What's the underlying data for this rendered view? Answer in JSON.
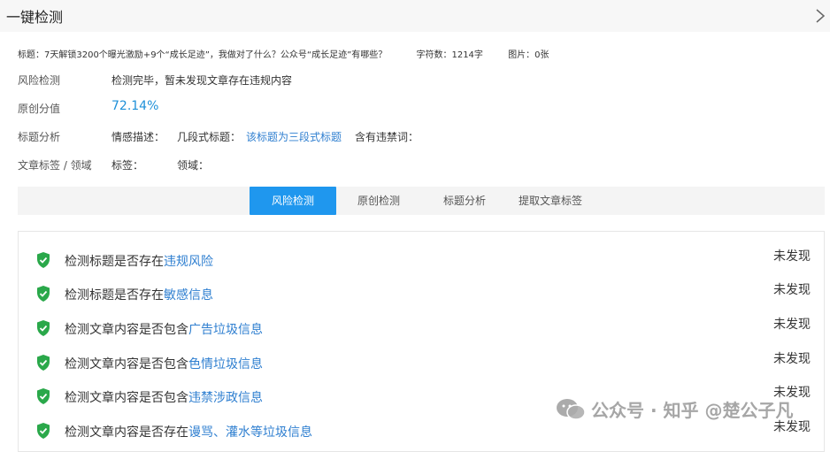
{
  "header": {
    "title": "一键检测"
  },
  "info": {
    "title_text": "标题：7天解锁3200个曝光激励+9个“成长足迹”，我做对了什么？公众号“成长足迹”有哪些？",
    "word_count": "字符数：1214字",
    "images": "图片：0张"
  },
  "rows": {
    "risk": {
      "label": "风险检测",
      "value": "检测完毕，暂未发现文章存在违规内容"
    },
    "originality": {
      "label": "原创分值",
      "value": "72.14%"
    },
    "title_analysis": {
      "label": "标题分析",
      "sentiment": "情感描述：",
      "segments_label": "几段式标题：",
      "segments_value": "该标题为三段式标题",
      "banned": "含有违禁词："
    },
    "tags": {
      "label": "文章标签 / 领域",
      "tags_label": "标签：",
      "domain_label": "领域："
    }
  },
  "tabs": [
    "风险检测",
    "原创检测",
    "标题分析",
    "提取文章标签"
  ],
  "checks": [
    {
      "prefix": "检测标题是否存在",
      "link": "违规风险",
      "status": "未发现"
    },
    {
      "prefix": "检测标题是否存在",
      "link": "敏感信息",
      "status": "未发现"
    },
    {
      "prefix": "检测文章内容是否包含",
      "link": "广告垃圾信息",
      "status": "未发现"
    },
    {
      "prefix": "检测文章内容是否包含",
      "link": "色情垃圾信息",
      "status": "未发现"
    },
    {
      "prefix": "检测文章内容是否包含",
      "link": "违禁涉政信息",
      "status": "未发现"
    },
    {
      "prefix": "检测文章内容是否存在",
      "link": "谩骂、灌水等垃圾信息",
      "status": "未发现"
    }
  ],
  "watermark": "公众号 · 知乎 @楚公子凡",
  "colors": {
    "accent": "#1f97ee",
    "link": "#2f7fd0",
    "shield": "#2aa84a"
  },
  "icons": {
    "header": "chevron-right-icon",
    "check": "shield-check-icon",
    "watermark": "wechat-icon"
  }
}
